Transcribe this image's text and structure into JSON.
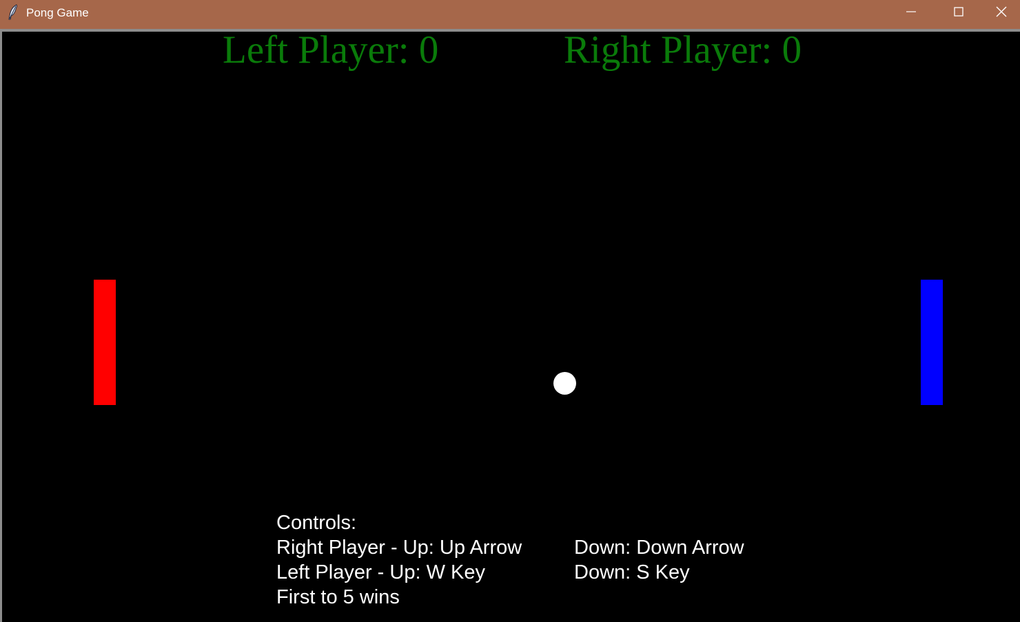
{
  "window": {
    "title": "Pong Game",
    "title_bar_color": "#a6674a",
    "icons": [
      "feather-icon",
      "minimize-icon",
      "maximize-icon",
      "close-icon"
    ]
  },
  "scoreboard": {
    "left_text": "Left Player: 0",
    "right_text": "Right Player: 0",
    "color": "#0a7b0a"
  },
  "game": {
    "left_paddle_color": "#ff0000",
    "right_paddle_color": "#0000ff",
    "ball_color": "#ffffff",
    "background_color": "#000000"
  },
  "controls": {
    "heading": "Controls:",
    "right_player_up": "Right Player - Up: Up Arrow",
    "right_player_down": "Down: Down Arrow",
    "left_player_up": "Left Player - Up: W Key",
    "left_player_down": "Down: S Key",
    "win_condition": "First to 5 wins"
  }
}
